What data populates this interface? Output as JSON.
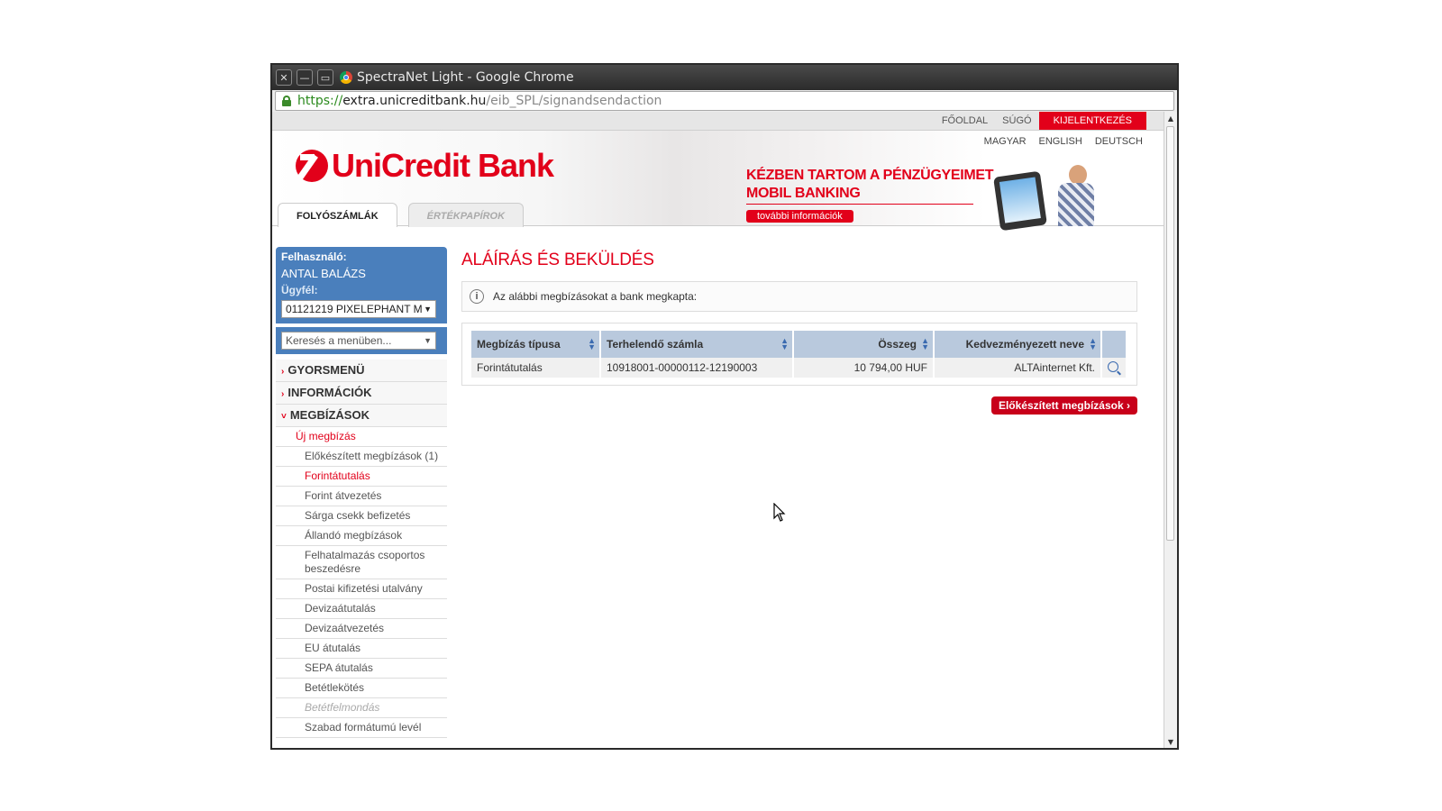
{
  "window": {
    "title": "SpectraNet Light - Google Chrome"
  },
  "url": {
    "scheme": "https://",
    "host": "extra.unicreditbank.hu",
    "path": "/eib_SPL/signandsendaction"
  },
  "topnav": {
    "home": "FŐOLDAL",
    "help": "SÚGÓ",
    "logout": "KIJELENTKEZÉS"
  },
  "languages": [
    "MAGYAR",
    "ENGLISH",
    "DEUTSCH"
  ],
  "brand": {
    "logo_text": "UniCredit Bank",
    "accent": "#e2001a"
  },
  "tabs": [
    {
      "label": "FOLYÓSZÁMLÁK",
      "active": true
    },
    {
      "label": "ÉRTÉKPAPÍROK",
      "active": false
    }
  ],
  "banner": {
    "line1": "KÉZBEN TARTOM A PÉNZÜGYEIMET",
    "line2": "MOBIL BANKING",
    "button": "további információk"
  },
  "sidebar": {
    "user_label": "Felhasználó:",
    "user_name": "ANTAL BALÁZS",
    "client_label": "Ügyfél:",
    "client_value": "01121219 PIXELEPHANT M",
    "search_placeholder": "Keresés a menüben...",
    "sections": [
      "GYORSMENÜ",
      "INFORMÁCIÓK",
      "MEGBÍZÁSOK"
    ],
    "submenu_title": "Új megbízás",
    "items": [
      "Előkészített megbízások (1)",
      "Forintátutalás",
      "Forint átvezetés",
      "Sárga csekk befizetés",
      "Állandó megbízások",
      "Felhatalmazás csoportos beszedésre",
      "Postai kifizetési utalvány",
      "Devizaátutalás",
      "Devizaátvezetés",
      "EU átutalás",
      "SEPA átutalás",
      "Betétlekötés",
      "Betétfelmondás",
      "Szabad formátumú levél"
    ]
  },
  "main": {
    "title": "ALÁÍRÁS ÉS BEKÜLDÉS",
    "info": "Az alábbi megbízásokat a bank megkapta:",
    "columns": [
      "Megbízás típusa",
      "Terhelendő számla",
      "Összeg",
      "Kedvezményezett neve"
    ],
    "rows": [
      {
        "type": "Forintátutalás",
        "account": "10918001-00000112-12190003",
        "amount": "10 794,00 HUF",
        "beneficiary": "ALTAinternet Kft."
      }
    ],
    "prepared_button": "Előkészített megbízások"
  }
}
